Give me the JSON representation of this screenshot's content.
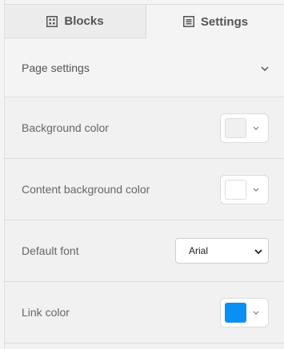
{
  "tabs": {
    "blocks": {
      "label": "Blocks",
      "icon": "grid-icon"
    },
    "settings": {
      "label": "Settings",
      "icon": "list-icon"
    }
  },
  "page_settings": {
    "title": "Page settings"
  },
  "rows": {
    "background_color": {
      "label": "Background color",
      "color": "#f0f0f0"
    },
    "content_background_color": {
      "label": "Content background color",
      "color": "#ffffff"
    },
    "default_font": {
      "label": "Default font",
      "value": "Arial"
    },
    "link_color": {
      "label": "Link color",
      "color": "#0a8ff5"
    }
  }
}
